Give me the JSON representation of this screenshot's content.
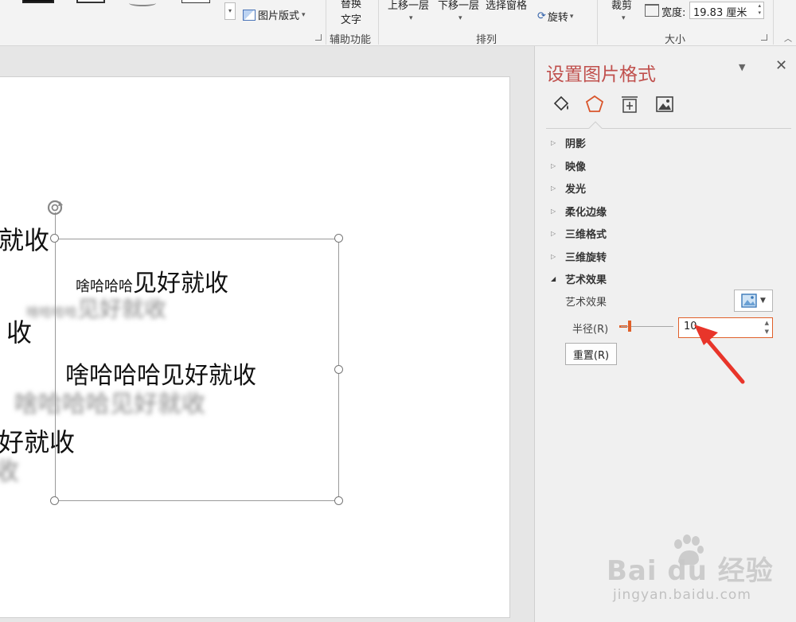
{
  "ribbon": {
    "picture_layout": "图片版式",
    "alt_text_line1": "替换",
    "alt_text_line2": "文字",
    "accessibility_group": "辅助功能",
    "bring_forward": "上移一层",
    "send_backward": "下移一层",
    "selection_pane": "选择窗格",
    "rotate": "旋转",
    "arrange_group": "排列",
    "crop": "裁剪",
    "width_label": "宽度:",
    "width_value": "19.83 厘米",
    "size_group": "大小"
  },
  "slide": {
    "lines": [
      {
        "text": "就收"
      },
      {
        "text_small": "啥哈哈哈",
        "text_large": "见好就收"
      },
      {
        "text_small": "啥哈哈哈",
        "text_large": "见好就收"
      },
      {
        "text": "收"
      },
      {
        "text": "啥哈哈哈见好就收"
      },
      {
        "text": "啥哈哈哈见好就收"
      },
      {
        "text": "好就收"
      },
      {
        "text": "收"
      }
    ]
  },
  "panel": {
    "title": "设置图片格式",
    "sections": [
      {
        "label": "阴影",
        "expanded": false
      },
      {
        "label": "映像",
        "expanded": false
      },
      {
        "label": "发光",
        "expanded": false
      },
      {
        "label": "柔化边缘",
        "expanded": false
      },
      {
        "label": "三维格式",
        "expanded": false
      },
      {
        "label": "三维旋转",
        "expanded": false
      },
      {
        "label": "艺术效果",
        "expanded": true
      }
    ],
    "artistic_effect_label": "艺术效果",
    "radius_label": "半径(R)",
    "radius_value": "10",
    "reset_label": "重置(R)"
  },
  "watermark": {
    "brand": "Bai du 经验",
    "url": "jingyan.baidu.com"
  },
  "colors": {
    "accent": "#c0504d",
    "slider": "#e0602a"
  }
}
